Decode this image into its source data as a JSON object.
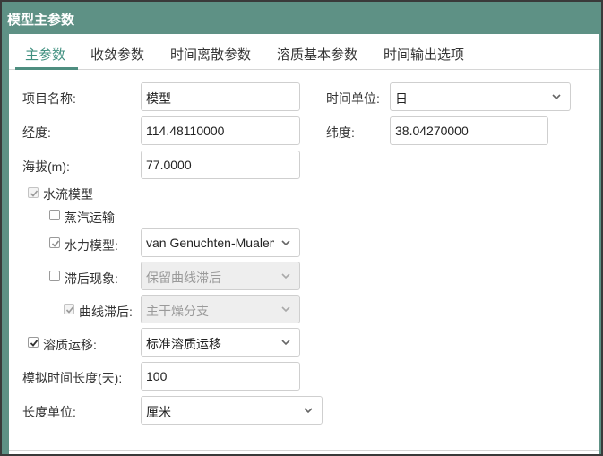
{
  "window": {
    "title": "模型主参数"
  },
  "tabs": [
    {
      "label": "主参数",
      "active": true
    },
    {
      "label": "收敛参数",
      "active": false
    },
    {
      "label": "时间离散参数",
      "active": false
    },
    {
      "label": "溶质基本参数",
      "active": false
    },
    {
      "label": "时间输出选项",
      "active": false
    }
  ],
  "form": {
    "project_name_label": "项目名称:",
    "project_name_value": "模型",
    "time_unit_label": "时间单位:",
    "time_unit_value": "日",
    "longitude_label": "经度:",
    "longitude_value": "114.48110000",
    "latitude_label": "纬度:",
    "latitude_value": "38.04270000",
    "altitude_label": "海拔(m):",
    "altitude_value": "77.0000",
    "water_flow_label": "水流模型",
    "water_flow_checked": true,
    "vapor_label": "蒸汽运输",
    "vapor_checked": false,
    "hydraulic_label": "水力模型:",
    "hydraulic_checked": true,
    "hydraulic_value": "van Genuchten-Mualem",
    "hysteresis_label": "滞后现象:",
    "hysteresis_checked": false,
    "hysteresis_value": "保留曲线滞后",
    "curve_hysteresis_label": "曲线滞后:",
    "curve_hysteresis_checked": true,
    "curve_hysteresis_value": "主干燥分支",
    "solute_label": "溶质运移:",
    "solute_checked": true,
    "solute_value": "标准溶质运移",
    "sim_time_label": "模拟时间长度(天):",
    "sim_time_value": "100",
    "length_unit_label": "长度单位:",
    "length_unit_value": "厘米"
  },
  "colors": {
    "titlebar": "#5e9185",
    "accent": "#4e8e80"
  }
}
